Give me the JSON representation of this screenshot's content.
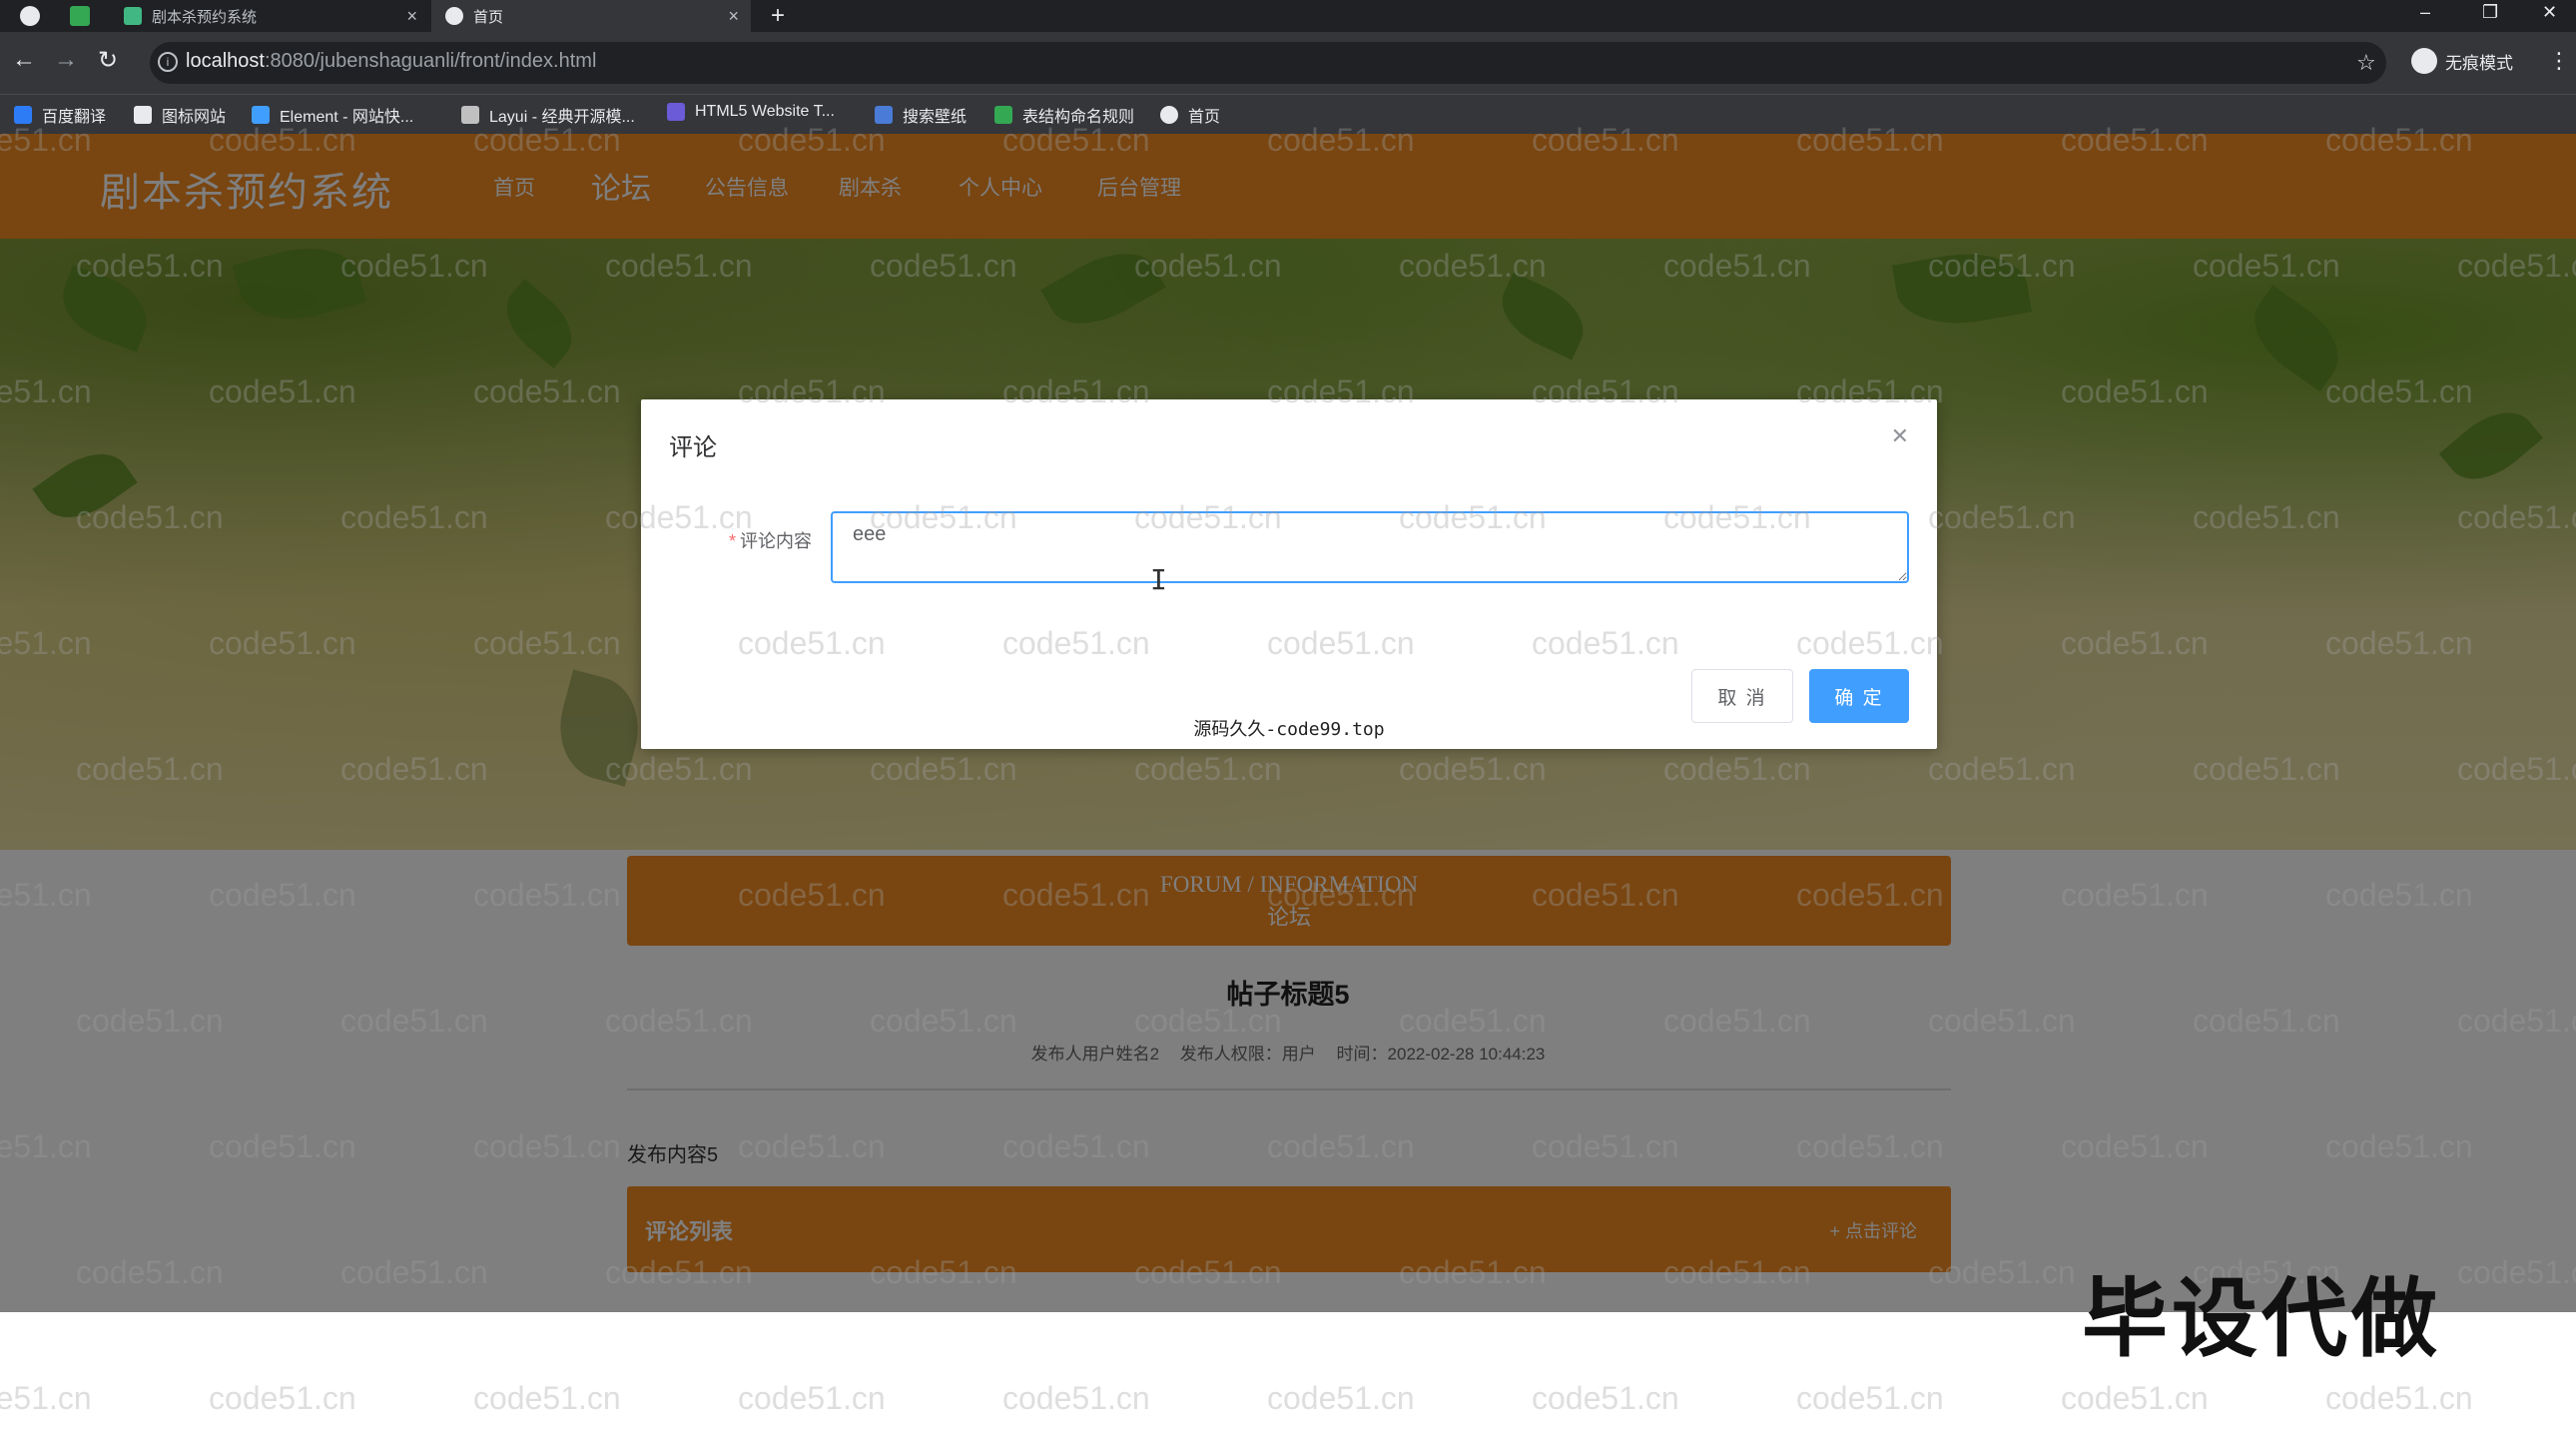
{
  "browser": {
    "tabs": [
      {
        "label": "剧本杀预约系统",
        "active": false
      },
      {
        "label": "首页",
        "active": true
      }
    ],
    "url_host": "localhost",
    "url_rest": ":8080/jubenshaguanli/front/index.html",
    "profile_label": "无痕模式",
    "bookmarks": [
      "百度翻译",
      "图标网站",
      "Element - 网站快...",
      "Layui - 经典开源模...",
      "HTML5 Website T...",
      "搜索壁纸",
      "表结构命名规则",
      "首页"
    ]
  },
  "site": {
    "brand": "剧本杀预约系统",
    "nav": [
      "首页",
      "论坛",
      "公告信息",
      "剧本杀",
      "个人中心",
      "后台管理"
    ],
    "active_nav_index": 1,
    "accent_color": "#f28a20"
  },
  "forum": {
    "banner_en": "FORUM / INFORMATION",
    "banner_cn": "论坛",
    "post_title": "帖子标题5",
    "meta": {
      "author": "发布人用户姓名2",
      "role": "发布人权限：用户",
      "time": "时间：2022-02-28 10:44:23"
    },
    "content": "发布内容5",
    "comment_list_label": "评论列表",
    "add_comment_label": "+ 点击评论"
  },
  "dialog": {
    "title": "评论",
    "field_label": "评论内容",
    "field_value": "eee",
    "cancel_label": "取 消",
    "ok_label": "确 定",
    "primary_color": "#409eff"
  },
  "overlay_texts": {
    "source": "源码久久-code99.top",
    "watermark": "code51.cn",
    "promo": "毕设代做"
  }
}
